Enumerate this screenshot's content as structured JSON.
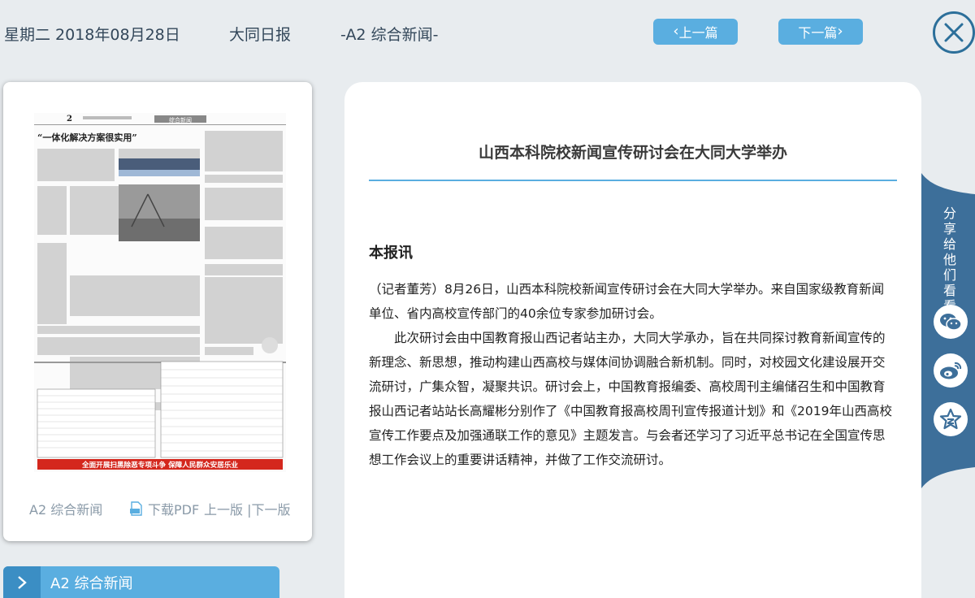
{
  "header": {
    "date": "星期二 2018年08月28日",
    "paper_name": "大同日报",
    "section": "-A2 综合新闻-",
    "prev_label": "上一篇",
    "next_label": "下一篇"
  },
  "thumbnail": {
    "section_label": "A2 综合新闻",
    "pdf_label": "下载PDF",
    "page_links": "上一版 |下一版"
  },
  "section_bar": {
    "label": "A2  综合新闻"
  },
  "article": {
    "title": "山西本科院校新闻宣传研讨会在大同大学举办",
    "lead": "本报讯",
    "paragraph1": "（记者董芳）8月26日，山西本科院校新闻宣传研讨会在大同大学举办。来自国家级教育新闻单位、省内高校宣传部门的40余位专家参加研讨会。",
    "paragraph2": "此次研讨会由中国教育报山西记者站主办，大同大学承办，旨在共同探讨教育新闻宣传的新理念、新思想，推动构建山西高校与媒体间协调融合新机制。同时，对校园文化建设展开交流研讨，广集众智，凝聚共识。研讨会上，中国教育报编委、高校周刊主编储召生和中国教育报山西记者站站长高耀彬分别作了《中国教育报高校周刊宣传报道计划》和《2019年山西高校宣传工作要点及加强通联工作的意见》主题发言。与会者还学习了习近平总书记在全国宣传思想工作会议上的重要讲话精神，并做了工作交流研讨。"
  },
  "share": {
    "label": "分享给他们看看",
    "icons": [
      "wechat-icon",
      "weibo-icon",
      "qzone-icon"
    ]
  },
  "newspaper_preview": {
    "headline1": "“一体化解决方案很实用”",
    "page_no": "2",
    "banner": "综合新闻",
    "bottom_slogan": "全面开展扫黑除恶专项斗争 保障人民群众安居乐业"
  },
  "colors": {
    "accent": "#5aaee0",
    "dark_accent": "#2c6f9a"
  }
}
